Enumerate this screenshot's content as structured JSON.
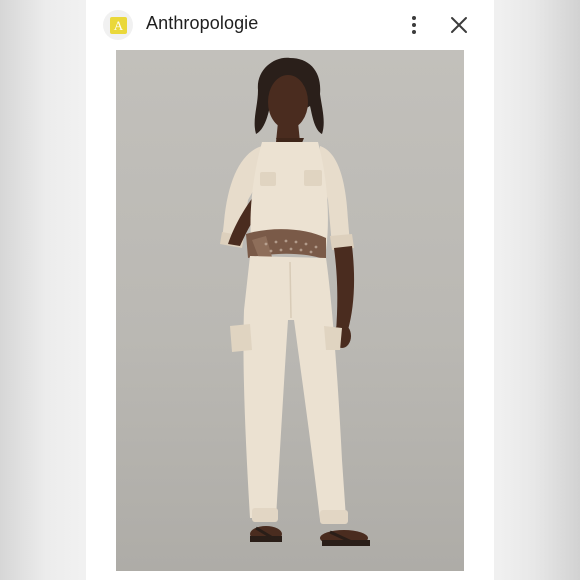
{
  "app": {
    "title": "Anthropologie",
    "icon_letter": "A",
    "icon_name": "anthropologie-app-icon",
    "brand_color": "#ead83a"
  },
  "header": {
    "menu_icon": "more-vert-icon",
    "close_icon": "close-icon"
  },
  "product_image": {
    "subject": "model-wearing-cream-utility-jumpsuit"
  }
}
